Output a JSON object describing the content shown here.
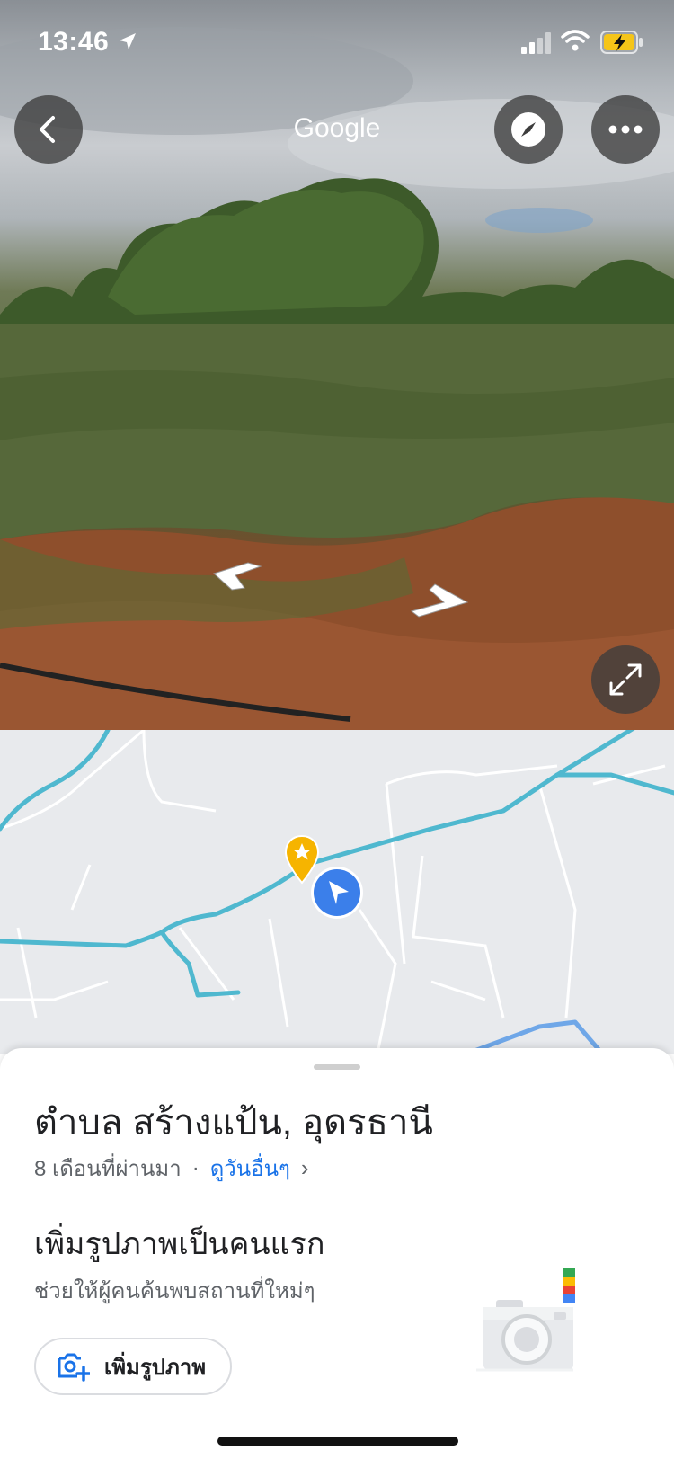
{
  "status_bar": {
    "time": "13:46",
    "location_icon": "location-arrow-icon",
    "signal_icon": "cell-signal-icon",
    "wifi_icon": "wifi-icon",
    "battery_icon": "battery-charging-icon"
  },
  "street_view": {
    "title": "Google",
    "back_icon": "chevron-left-icon",
    "compass_icon": "compass-icon",
    "more_icon": "more-horizontal-icon",
    "expand_icon": "expand-icon"
  },
  "map": {
    "pin_icon": "star-pin-icon",
    "user_icon": "user-location-arrow-icon"
  },
  "sheet": {
    "place_title": "ตำบล สร้างแป้น, อุดรธานี",
    "date_text": "8 เดือนที่ผ่านมา",
    "separator": "·",
    "see_other_link": "ดูวันอื่นๆ",
    "chevron": "›",
    "add_photo_title": "เพิ่มรูปภาพเป็นคนแรก",
    "add_photo_subtitle": "ช่วยให้ผู้คนค้นพบสถานที่ใหม่ๆ",
    "add_photo_button": "เพิ่มรูปภาพ"
  },
  "colors": {
    "accent": "#1a73e8",
    "road": "#4fb8cf",
    "pin": "#f6b400"
  }
}
